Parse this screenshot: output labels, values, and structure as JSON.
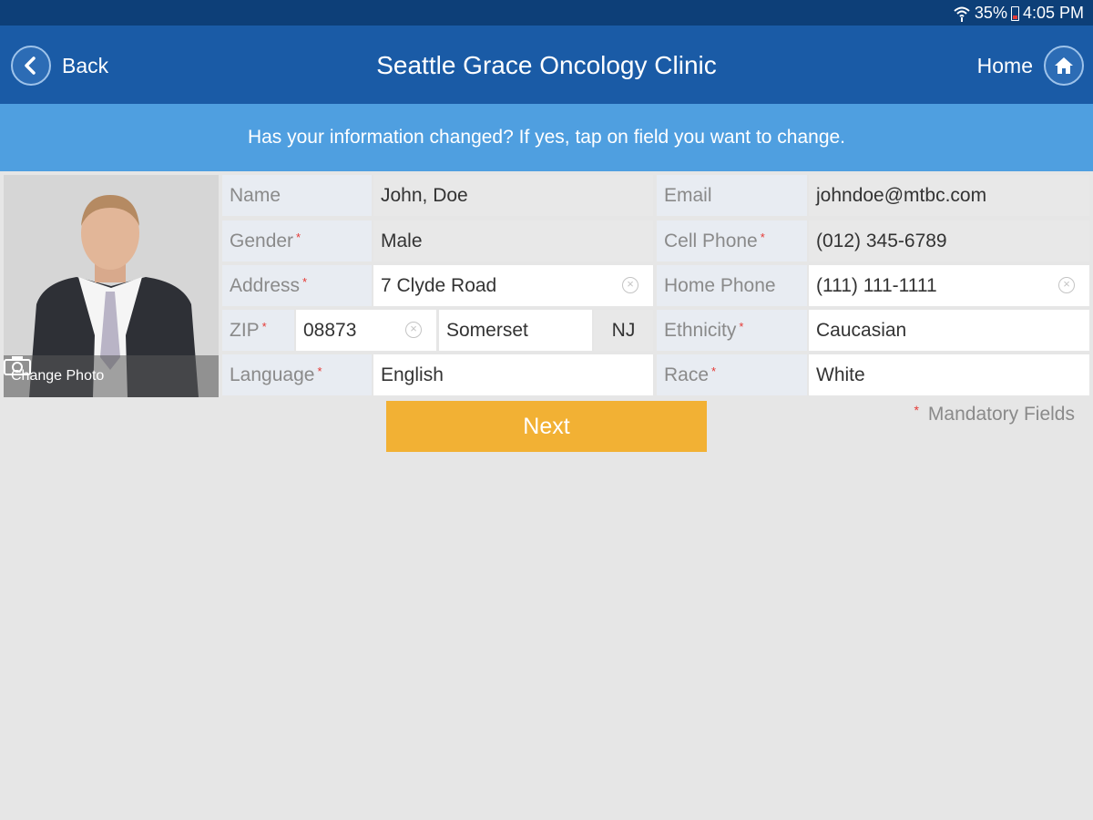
{
  "status_bar": {
    "battery": "35%",
    "time": "4:05 PM"
  },
  "header": {
    "back_label": "Back",
    "title": "Seattle Grace Oncology Clinic",
    "home_label": "Home"
  },
  "banner": {
    "text": "Has your information changed? If yes, tap on field you want to change."
  },
  "photo": {
    "change_label": "Change Photo"
  },
  "form": {
    "name": {
      "label": "Name",
      "value": "John, Doe"
    },
    "gender": {
      "label": "Gender",
      "value": "Male"
    },
    "address": {
      "label": "Address",
      "value": "7 Clyde Road"
    },
    "zip": {
      "label": "ZIP",
      "value": "08873",
      "city": "Somerset",
      "state": "NJ"
    },
    "language": {
      "label": "Language",
      "value": "English"
    },
    "email": {
      "label": "Email",
      "value": "johndoe@mtbc.com"
    },
    "cell_phone": {
      "label": "Cell Phone",
      "value": "(012) 345-6789"
    },
    "home_phone": {
      "label": "Home Phone",
      "value": "(111) 111-1111"
    },
    "ethnicity": {
      "label": "Ethnicity",
      "value": "Caucasian"
    },
    "race": {
      "label": "Race",
      "value": "White"
    }
  },
  "required_mark": "*",
  "clear_glyph": "×",
  "mandatory_text": "Mandatory Fields",
  "next_label": "Next",
  "colors": {
    "header": "#1a5ba6",
    "status_bar": "#0d3f78",
    "banner": "#4f9fe0",
    "next_button": "#f2b134",
    "required": "#e53935"
  },
  "icons": [
    "wifi-icon",
    "battery-icon",
    "back-arrow-icon",
    "home-icon",
    "camera-icon",
    "clear-icon"
  ]
}
